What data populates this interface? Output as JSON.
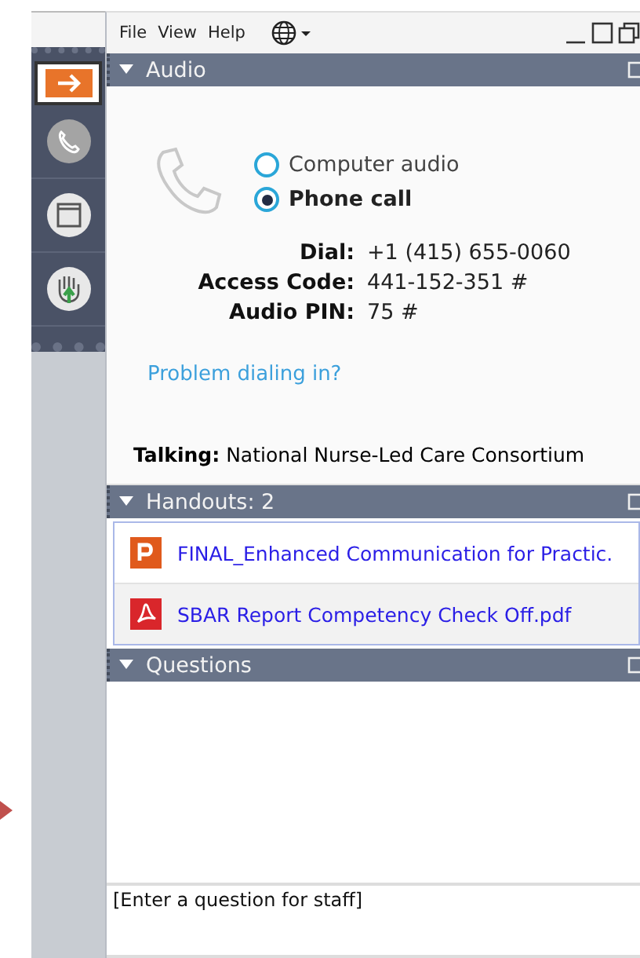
{
  "menu": [
    {
      "label": "File"
    },
    {
      "label": "View"
    },
    {
      "label": "Help"
    }
  ],
  "sidebar": {
    "tools": [
      {
        "kind": "arrow",
        "selected": true
      },
      {
        "kind": "phone",
        "selected": false
      },
      {
        "kind": "window",
        "selected": false
      },
      {
        "kind": "hand",
        "selected": false
      }
    ]
  },
  "audio": {
    "title": "Audio",
    "expanded": true,
    "options": [
      {
        "label": "Computer audio",
        "selected": false
      },
      {
        "label": "Phone call",
        "selected": true
      }
    ],
    "details": [
      {
        "label": "Dial:",
        "value": "+1 (415) 655-0060"
      },
      {
        "label": "Access Code:",
        "value": "441-152-351 #"
      },
      {
        "label": "Audio PIN:",
        "value": "75 #"
      }
    ],
    "help_link": "Problem dialing in?",
    "talking": {
      "label": "Talking:",
      "name": "National Nurse-Led Care Consortium"
    }
  },
  "handouts": {
    "title": "Handouts: 2",
    "expanded": true,
    "files": [
      {
        "name": "FINAL_Enhanced Communication for Practic.",
        "kind": "presentation"
      },
      {
        "name": "SBAR Report Competency Check Off.pdf",
        "kind": "pdf"
      }
    ]
  },
  "questions": {
    "title": "Questions",
    "expanded": true,
    "placeholder": "[Enter a question for staff]"
  }
}
